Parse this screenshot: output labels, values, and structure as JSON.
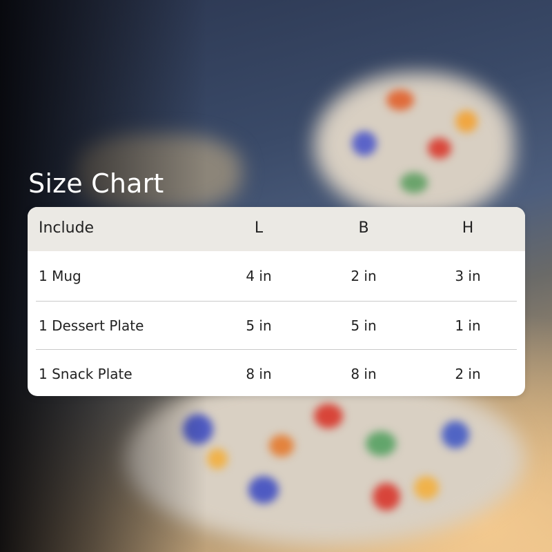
{
  "title": "Size Chart",
  "table": {
    "headers": [
      "Include",
      "L",
      "B",
      "H"
    ],
    "rows": [
      [
        "1 Mug",
        "4 in",
        "2 in",
        "3 in"
      ],
      [
        "1 Dessert Plate",
        "5 in",
        "5 in",
        "1 in"
      ],
      [
        "1 Snack Plate",
        "8 in",
        "8 in",
        "2 in"
      ]
    ]
  }
}
